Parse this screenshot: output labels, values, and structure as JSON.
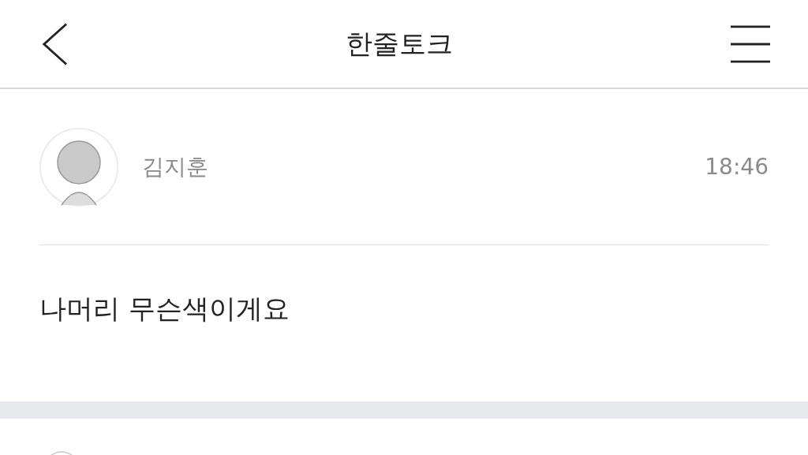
{
  "header": {
    "title": "한줄토크"
  },
  "post": {
    "author": "김지훈",
    "time": "18:46",
    "message": "나머리 무슨색이게요"
  }
}
